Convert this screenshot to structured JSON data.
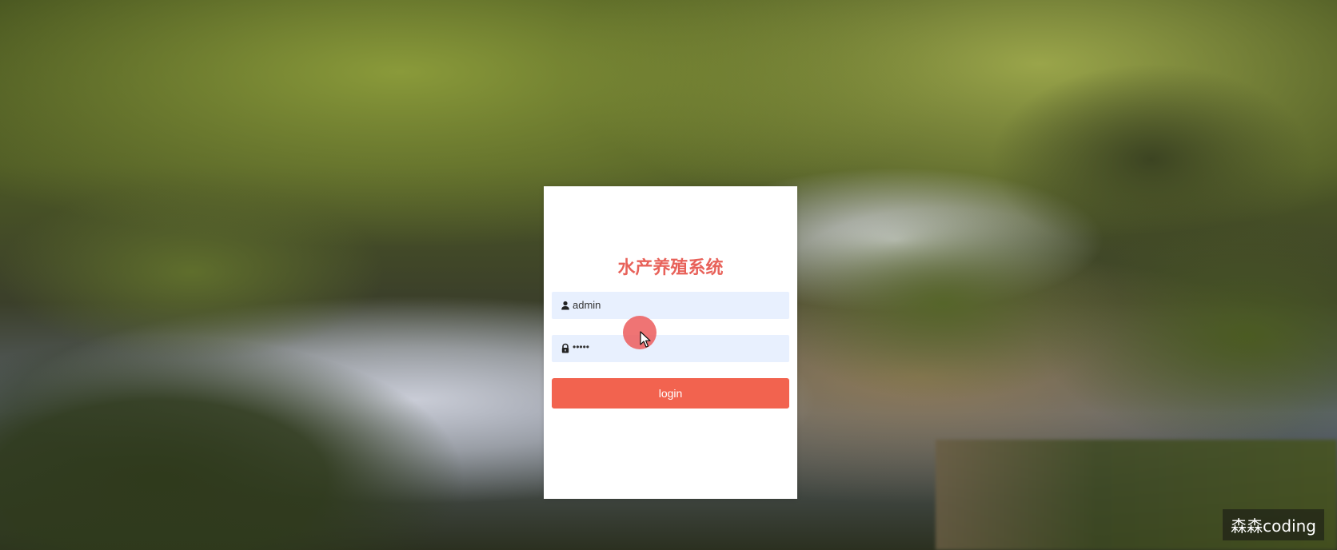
{
  "login": {
    "title": "水产养殖系统",
    "username_value": "admin",
    "password_value": "•••••",
    "login_label": "login"
  },
  "watermark": {
    "text": "森森coding"
  },
  "colors": {
    "title": "#e8625a",
    "button": "#f2634f",
    "input_bg": "#e8f0fe",
    "cursor_highlight": "#ec5c5c"
  },
  "icons": {
    "username": "user-icon",
    "password": "lock-icon",
    "pointer": "mouse-cursor-icon"
  }
}
